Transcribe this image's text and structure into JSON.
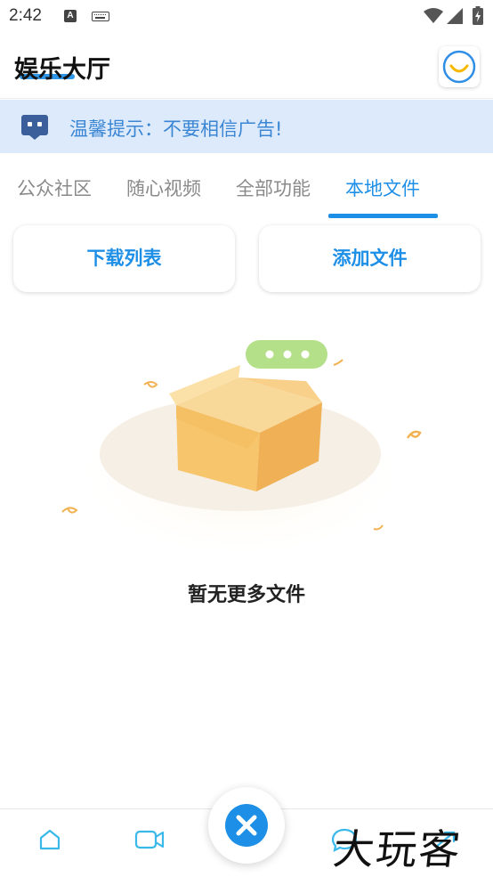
{
  "status_bar": {
    "time": "2:42",
    "icons": [
      "a-icon",
      "keyboard-icon",
      "wifi-icon",
      "signal-icon",
      "battery-icon"
    ]
  },
  "header": {
    "title": "娱乐大厅",
    "avatar_icon": "smile-icon",
    "accent_color": "#2f96e8"
  },
  "notice": {
    "icon": "robot-icon",
    "text": "温馨提示：不要相信广告!"
  },
  "tabs": [
    {
      "label": "公众社区",
      "active": false
    },
    {
      "label": "随心视频",
      "active": false
    },
    {
      "label": "全部功能",
      "active": false
    },
    {
      "label": "本地文件",
      "active": true
    }
  ],
  "actions": {
    "download_list_label": "下载列表",
    "add_file_label": "添加文件"
  },
  "empty_state": {
    "icon": "empty-box-icon",
    "text": "暂无更多文件"
  },
  "bottom_nav": {
    "items": [
      "home-icon",
      "video-icon",
      "close-icon",
      "chat-icon",
      "share-icon"
    ]
  },
  "watermark": {
    "text": "大玩客"
  },
  "colors": {
    "primary": "#1e8fe6",
    "notice_bg": "#ddeafb",
    "box": "#f7c56b"
  }
}
